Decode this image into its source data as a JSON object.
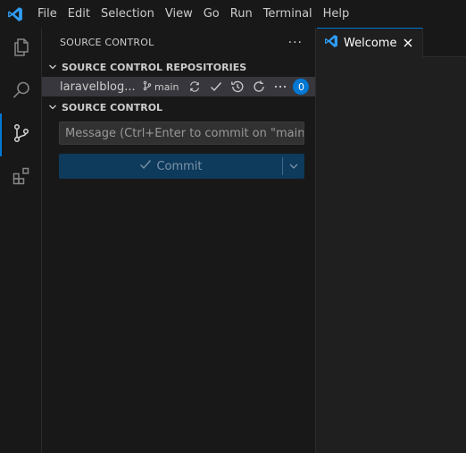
{
  "menubar": {
    "items": [
      "File",
      "Edit",
      "Selection",
      "View",
      "Go",
      "Run",
      "Terminal",
      "Help"
    ]
  },
  "activitybar": {
    "items": [
      "explorer-icon",
      "search-icon",
      "source-control-icon",
      "extensions-icon"
    ],
    "active": "source-control-icon"
  },
  "sidebar": {
    "title": "SOURCE CONTROL",
    "more_label": "···",
    "repositories_section": "SOURCE CONTROL REPOSITORIES",
    "repo": {
      "name": "laravelblog...",
      "branch": "main",
      "badge": "0"
    },
    "scm_section": "SOURCE CONTROL",
    "commit_placeholder": "Message (Ctrl+Enter to commit on \"main\")",
    "commit_label": "Commit"
  },
  "editor": {
    "tab_label": "Welcome"
  },
  "colors": {
    "accent": "#0078d4",
    "commit_button_bg": "#0e3a5c"
  }
}
